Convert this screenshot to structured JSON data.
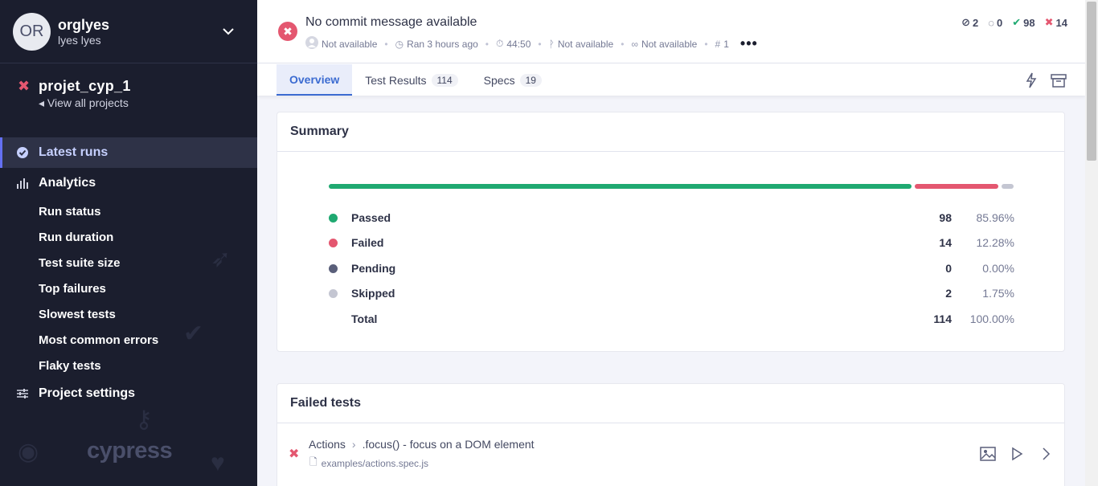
{
  "org": {
    "initials": "OR",
    "name": "orglyes",
    "user": "lyes lyes"
  },
  "project": {
    "name": "projet_cyp_1",
    "view_all": "View all projects"
  },
  "nav": {
    "latest_runs": "Latest runs",
    "analytics": "Analytics",
    "analytics_items": [
      "Run status",
      "Run duration",
      "Test suite size",
      "Top failures",
      "Slowest tests",
      "Most common errors",
      "Flaky tests"
    ],
    "project_settings": "Project settings"
  },
  "brand_logo": "cypress",
  "run": {
    "commit_message": "No commit message available",
    "author": "Not available",
    "ran": "Ran 3 hours ago",
    "duration": "44:50",
    "branch": "Not available",
    "ci": "Not available",
    "run_number": "1",
    "counts": {
      "skipped": "2",
      "pending": "0",
      "passed": "98",
      "failed": "14"
    }
  },
  "tabs": [
    {
      "label": "Overview",
      "count": ""
    },
    {
      "label": "Test Results",
      "count": "114"
    },
    {
      "label": "Specs",
      "count": "19"
    }
  ],
  "summary": {
    "title": "Summary",
    "rows": [
      {
        "label": "Passed",
        "count": "98",
        "percent": "85.96%",
        "color": "#1fa971"
      },
      {
        "label": "Failed",
        "count": "14",
        "percent": "12.28%",
        "color": "#e45770"
      },
      {
        "label": "Pending",
        "count": "0",
        "percent": "0.00%",
        "color": "#5a5f7a"
      },
      {
        "label": "Skipped",
        "count": "2",
        "percent": "1.75%",
        "color": "#c4c6d2"
      }
    ],
    "total": {
      "label": "Total",
      "count": "114",
      "percent": "100.00%"
    },
    "bar_fractions": {
      "passed": 0.8596,
      "failed": 0.1228,
      "pending": 0.0,
      "skipped": 0.0175
    }
  },
  "failed_tests": {
    "title": "Failed tests",
    "items": [
      {
        "suite": "Actions",
        "name": ".focus() - focus on a DOM element",
        "file": "examples/actions.spec.js"
      }
    ]
  },
  "colors": {
    "passed": "#1fa971",
    "failed": "#e45770",
    "accent": "#3b6bd1",
    "sidebar": "#1b1e2e"
  }
}
